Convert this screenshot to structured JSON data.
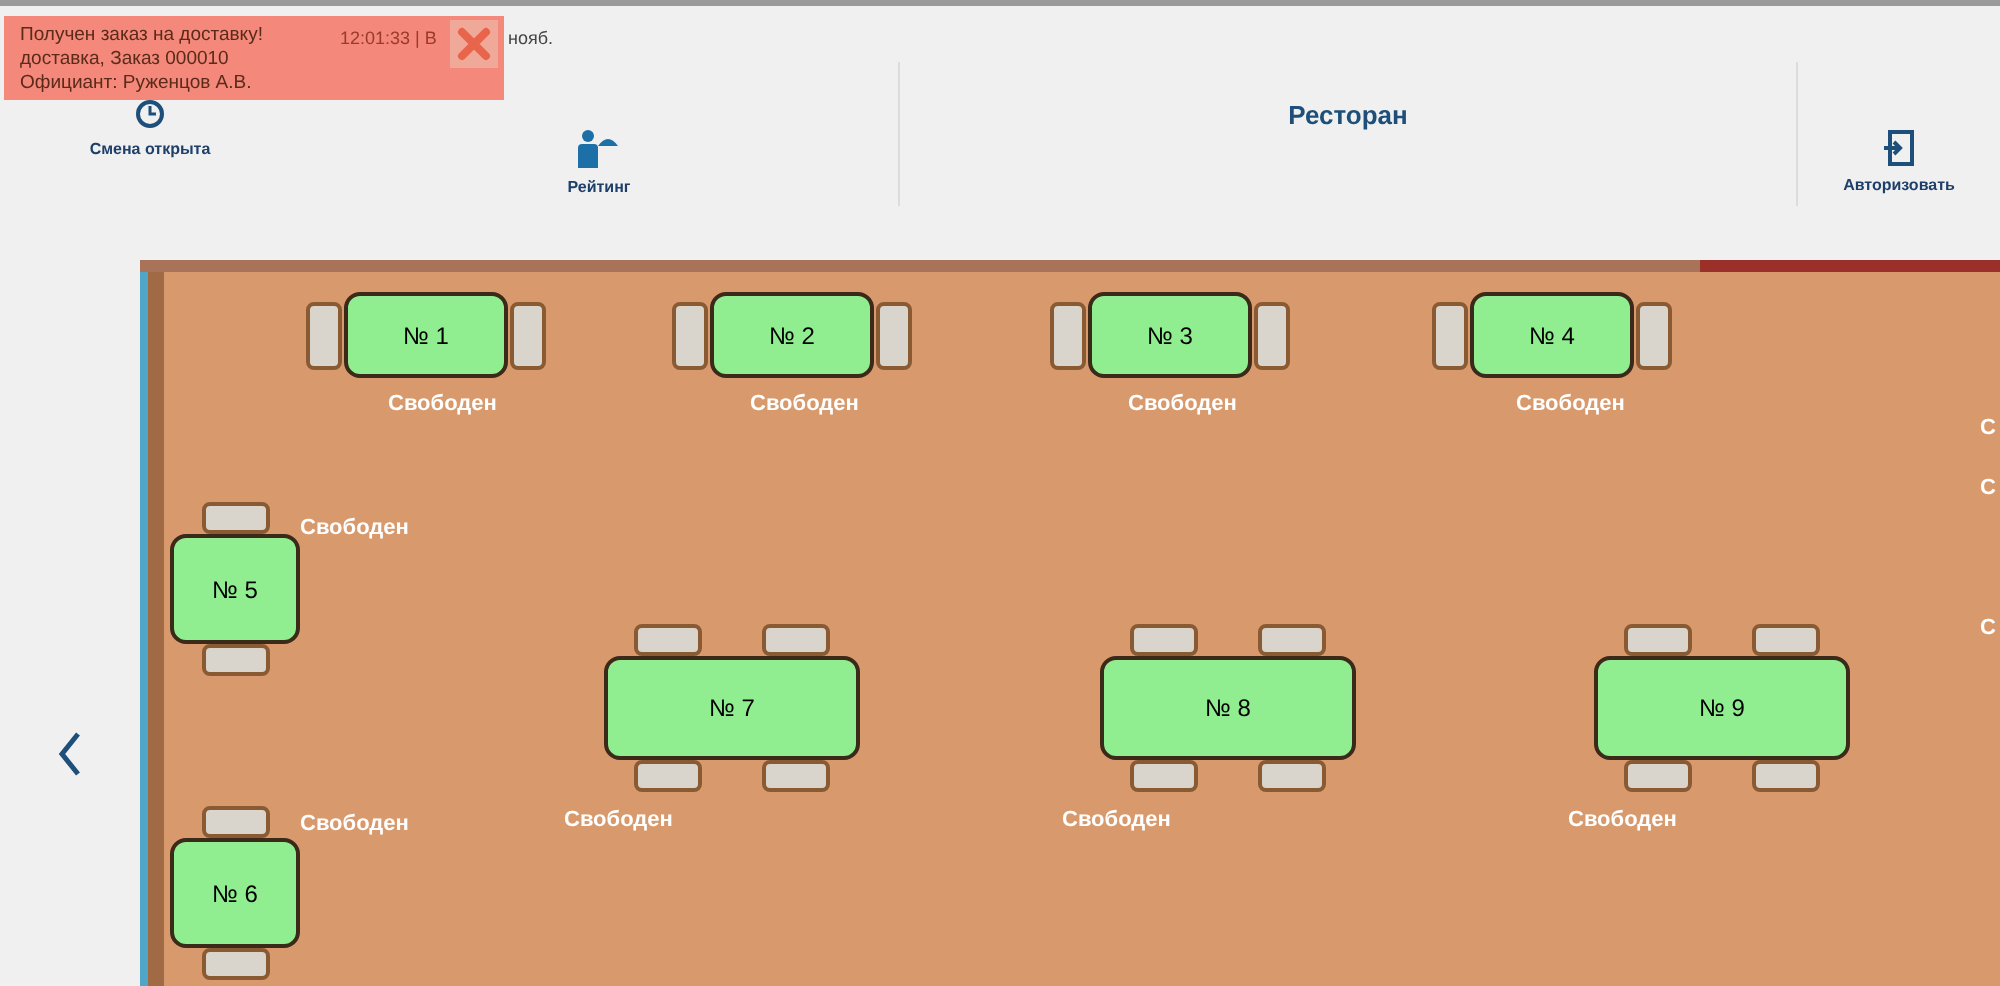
{
  "notification": {
    "lines": [
      "Получен заказ на доставку!",
      "доставка, Заказ 000010",
      "Официант: Руженцов А.В."
    ]
  },
  "header": {
    "time": "12:01:33 | В",
    "date": "нояб."
  },
  "toolbar": [
    {
      "kind": "shift",
      "label": "Смена открыта"
    },
    {
      "kind": "rating",
      "label": "Рейтинг"
    },
    {
      "kind": "title",
      "label": "Ресторан"
    },
    {
      "kind": "login",
      "label": "Авторизовать"
    }
  ],
  "hall": {
    "tables": [
      {
        "kind": "pair",
        "name": "№ 1",
        "status": "Свободен"
      },
      {
        "kind": "pair",
        "name": "№ 2",
        "status": "Свободен"
      },
      {
        "kind": "pair",
        "name": "№ 3",
        "status": "Свободен"
      },
      {
        "kind": "pair",
        "name": "№ 4",
        "status": "Свободен"
      },
      {
        "kind": "square",
        "name": "№ 5",
        "status": "Свободен"
      },
      {
        "kind": "square",
        "name": "№ 6",
        "status": "Свободен"
      },
      {
        "kind": "long",
        "name": "№ 7",
        "status": "Свободен"
      },
      {
        "kind": "long",
        "name": "№ 8",
        "status": "Свободен"
      },
      {
        "kind": "long",
        "name": "№ 9",
        "status": "Свободен"
      }
    ],
    "edge_labels": [
      "С",
      "С",
      "С"
    ]
  }
}
